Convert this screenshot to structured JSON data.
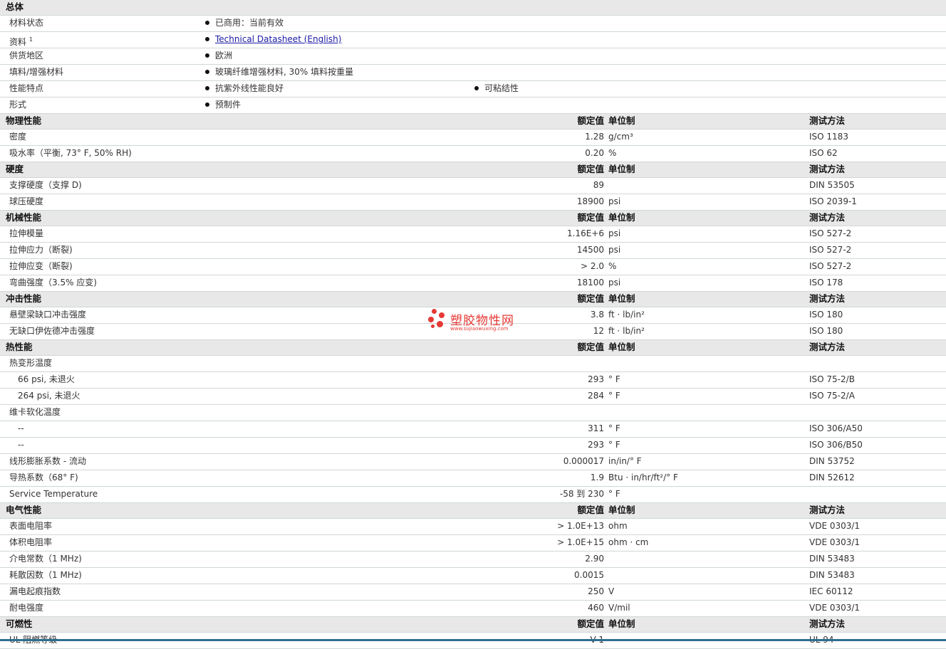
{
  "general": {
    "title": "总体",
    "rows": [
      {
        "label": "材料状态",
        "b1": "已商用：当前有效",
        "b2": ""
      },
      {
        "label": "资料",
        "sup": "1",
        "b1": "Technical Datasheet (English)",
        "b1_link": true,
        "b2": ""
      },
      {
        "label": "供货地区",
        "b1": "欧洲",
        "b2": ""
      },
      {
        "label": "填料/增强材料",
        "b1": "玻璃纤维增强材料, 30% 填料按重量",
        "b2": ""
      },
      {
        "label": "性能特点",
        "b1": "抗紫外线性能良好",
        "b2": "可粘结性"
      },
      {
        "label": "形式",
        "b1": "预制件",
        "b2": ""
      }
    ]
  },
  "headers": {
    "value": "额定值",
    "unit": "单位制",
    "test": "测试方法"
  },
  "sections": [
    {
      "title": "物理性能",
      "rows": [
        {
          "label": "密度",
          "value": "1.28",
          "unit": "g/cm³",
          "test": "ISO 1183"
        },
        {
          "label": "吸水率（平衡, 73° F, 50% RH)",
          "value": "0.20",
          "unit": "%",
          "test": "ISO 62"
        }
      ]
    },
    {
      "title": "硬度",
      "rows": [
        {
          "label": "支撑硬度（支撑 D)",
          "value": "89",
          "unit": "",
          "test": "DIN 53505"
        },
        {
          "label": "球压硬度",
          "value": "18900",
          "unit": "psi",
          "test": "ISO 2039-1"
        }
      ]
    },
    {
      "title": "机械性能",
      "rows": [
        {
          "label": "拉伸模量",
          "value": "1.16E+6",
          "unit": "psi",
          "test": "ISO 527-2"
        },
        {
          "label": "拉伸应力（断裂)",
          "value": "14500",
          "unit": "psi",
          "test": "ISO 527-2"
        },
        {
          "label": "拉伸应变（断裂)",
          "value": "> 2.0",
          "unit": "%",
          "test": "ISO 527-2"
        },
        {
          "label": "弯曲强度（3.5% 应变)",
          "value": "18100",
          "unit": "psi",
          "test": "ISO 178"
        }
      ]
    },
    {
      "title": "冲击性能",
      "rows": [
        {
          "label": "悬壁梁缺口冲击强度",
          "value": "3.8",
          "unit": "ft · lb/in²",
          "test": "ISO 180"
        },
        {
          "label": "无缺口伊佐德冲击强度",
          "value": "12",
          "unit": "ft · lb/in²",
          "test": "ISO 180"
        }
      ]
    },
    {
      "title": "热性能",
      "rows": [
        {
          "label": "热变形温度",
          "value": "",
          "unit": "",
          "test": ""
        },
        {
          "label": "66 psi, 未退火",
          "indent": true,
          "value": "293",
          "unit": "° F",
          "test": "ISO 75-2/B"
        },
        {
          "label": "264 psi, 未退火",
          "indent": true,
          "value": "284",
          "unit": "° F",
          "test": "ISO 75-2/A"
        },
        {
          "label": "维卡软化温度",
          "value": "",
          "unit": "",
          "test": ""
        },
        {
          "label": "--",
          "indent": true,
          "value": "311",
          "unit": "° F",
          "test": "ISO 306/A50"
        },
        {
          "label": "--",
          "indent": true,
          "value": "293",
          "unit": "° F",
          "test": "ISO 306/B50"
        },
        {
          "label": "线形膨胀系数 - 流动",
          "value": "0.000017",
          "unit": "in/in/° F",
          "test": "DIN 53752"
        },
        {
          "label": "导热系数（68° F)",
          "value": "1.9",
          "unit": "Btu · in/hr/ft²/° F",
          "test": "DIN 52612"
        },
        {
          "label": "Service Temperature",
          "value": "-58 到 230",
          "unit": "° F",
          "test": ""
        }
      ]
    },
    {
      "title": "电气性能",
      "rows": [
        {
          "label": "表面电阻率",
          "value": "> 1.0E+13",
          "unit": "ohm",
          "test": "VDE 0303/1"
        },
        {
          "label": "体积电阻率",
          "value": "> 1.0E+15",
          "unit": "ohm · cm",
          "test": "VDE 0303/1"
        },
        {
          "label": "介电常数（1 MHz)",
          "value": "2.90",
          "unit": "",
          "test": "DIN 53483"
        },
        {
          "label": "耗散因数（1 MHz)",
          "value": "0.0015",
          "unit": "",
          "test": "DIN 53483"
        },
        {
          "label": "漏电起痕指数",
          "value": "250",
          "unit": "V",
          "test": "IEC 60112"
        },
        {
          "label": "耐电强度",
          "value": "460",
          "unit": "V/mil",
          "test": "VDE 0303/1"
        }
      ]
    },
    {
      "title": "可燃性",
      "rows": [
        {
          "label": "UL 阻燃等级",
          "value": "V-1",
          "unit": "",
          "test": "UL 94"
        }
      ]
    }
  ],
  "watermark": {
    "name": "塑胶物性网",
    "url": "www.sujiaowuxing.com",
    "color": "#e53935"
  }
}
